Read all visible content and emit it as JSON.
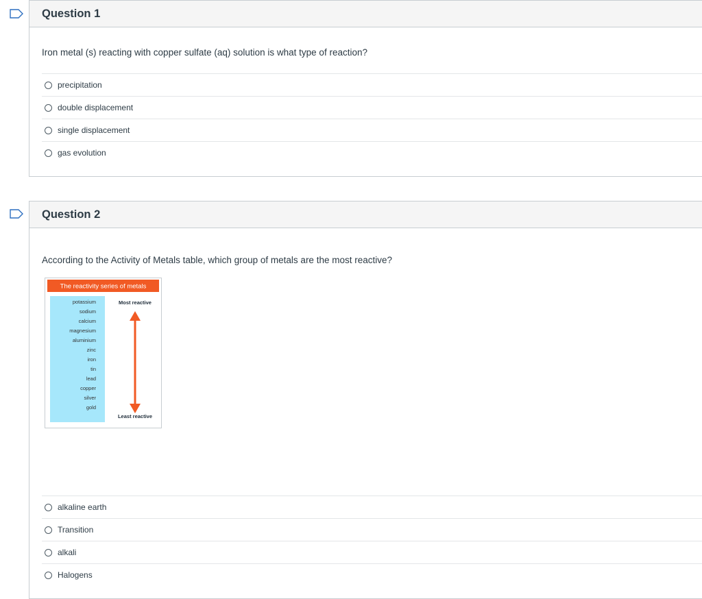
{
  "questions": [
    {
      "title": "Question 1",
      "text": "Iron metal (s) reacting with copper sulfate (aq) solution is what type of reaction?",
      "answers": [
        "precipitation",
        "double displacement",
        "single displacement",
        "gas evolution"
      ]
    },
    {
      "title": "Question 2",
      "text": "According to the Activity of Metals table, which group of metals are the most reactive?",
      "figure": {
        "title": "The reactivity series of metals",
        "metals": [
          "potassium",
          "sodium",
          "calcium",
          "magnesium",
          "aluminium",
          "zinc",
          "iron",
          "tin",
          "lead",
          "copper",
          "silver",
          "gold"
        ],
        "most_label": "Most reactive",
        "least_label": "Least reactive"
      },
      "answers": [
        "alkaline earth",
        "Transition",
        "alkali",
        "Halogens"
      ]
    }
  ],
  "colors": {
    "accent": "#2d3b45",
    "figure_title_bg": "#f15a24",
    "figure_list_bg": "#a6e7fb",
    "arrow": "#f15a24"
  },
  "icons": {
    "flag": "flag-icon",
    "radio": "radio-button"
  }
}
